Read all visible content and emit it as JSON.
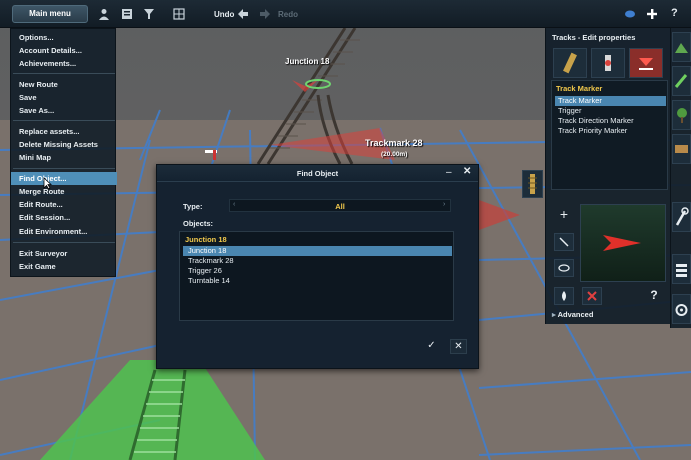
{
  "toolbar": {
    "main_menu_label": "Main menu",
    "undo_label": "Undo",
    "redo_label": "Redo",
    "icons": [
      "person-icon",
      "book-icon",
      "filter-icon",
      "grid-icon",
      "undo-arrow-icon",
      "redo-arrow-icon",
      "eye-icon",
      "plus-icon",
      "help-icon"
    ]
  },
  "main_menu": {
    "items": [
      {
        "label": "Options..."
      },
      {
        "label": "Account Details..."
      },
      {
        "label": "Achievements..."
      },
      {
        "label": "New Route"
      },
      {
        "label": "Save"
      },
      {
        "label": "Save As..."
      },
      {
        "label": "Replace assets..."
      },
      {
        "label": "Delete Missing Assets"
      },
      {
        "label": "Mini Map"
      },
      {
        "label": "Find Object...",
        "highlighted": true
      },
      {
        "label": "Merge Route"
      },
      {
        "label": "Edit Route..."
      },
      {
        "label": "Edit Session..."
      },
      {
        "label": "Edit Environment..."
      },
      {
        "label": "Exit Surveyor"
      },
      {
        "label": "Exit Game"
      }
    ]
  },
  "scene": {
    "junction_label": "Junction 18",
    "trackmark_label": "Trackmark 28",
    "trackmark_distance": "(20.00m)"
  },
  "find_dialog": {
    "title": "Find Object",
    "type_label": "Type:",
    "type_value": "All",
    "objects_label": "Objects:",
    "list_header": "Junction 18",
    "items": [
      "Junction 18",
      "Trackmark 28",
      "Trigger 26",
      "Turntable 14"
    ],
    "selected_index": 0,
    "ok_symbol": "✓",
    "cancel_symbol": "✕",
    "minimize_symbol": "–",
    "close_symbol": "✕"
  },
  "edit_panel": {
    "title": "Tracks - Edit properties",
    "list_header": "Track Marker",
    "items": [
      "Track Marker",
      "Trigger",
      "Track Direction Marker",
      "Track Priority Marker"
    ],
    "selected_index": 0,
    "add_symbol": "+",
    "help_symbol": "?",
    "advanced_label": "Advanced",
    "accent_color": "#8a2e2a",
    "selection_color": "#4a86b0",
    "header_color": "#f2c94c"
  }
}
